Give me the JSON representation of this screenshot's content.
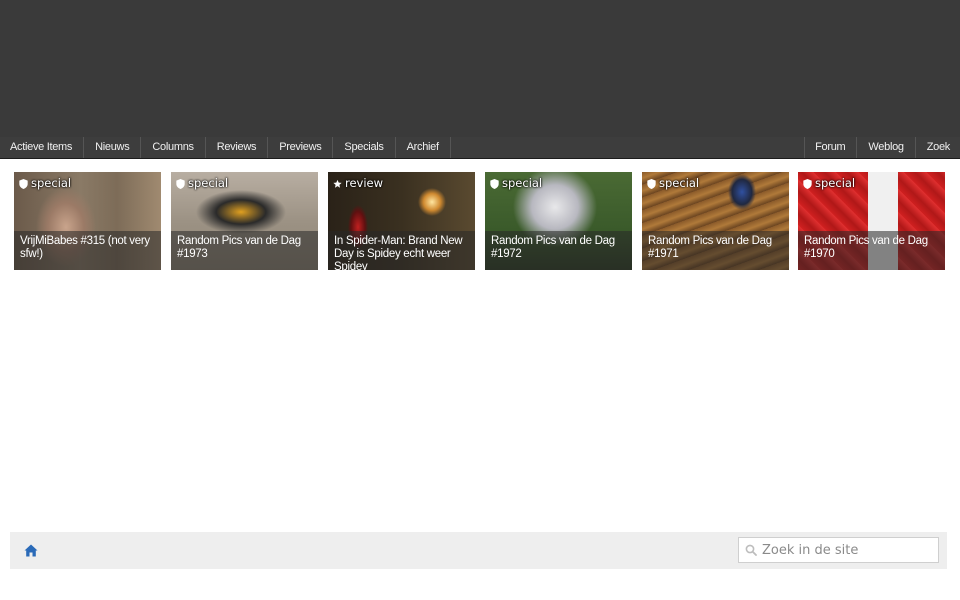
{
  "nav": {
    "left": [
      "Actieve Items",
      "Nieuws",
      "Columns",
      "Reviews",
      "Previews",
      "Specials",
      "Archief"
    ],
    "right": [
      "Forum",
      "Weblog",
      "Zoek"
    ]
  },
  "tiles": [
    {
      "tag": "special",
      "icon": "shield-icon",
      "title": "VrijMiBabes #315 (not very sfw!)"
    },
    {
      "tag": "special",
      "icon": "shield-icon",
      "title": "Random Pics van de Dag #1973"
    },
    {
      "tag": "review",
      "icon": "star-icon",
      "title": "In Spider-Man: Brand New Day is Spidey echt weer Spidey"
    },
    {
      "tag": "special",
      "icon": "shield-icon",
      "title": "Random Pics van de Dag #1972"
    },
    {
      "tag": "special",
      "icon": "shield-icon",
      "title": "Random Pics van de Dag #1971"
    },
    {
      "tag": "special",
      "icon": "shield-icon",
      "title": "Random Pics van de Dag #1970"
    }
  ],
  "footer": {
    "home_icon": "home-icon",
    "search_placeholder": "Zoek in de site"
  },
  "colors": {
    "banner": "#3a3a3a",
    "navbar": "#3d3d3d",
    "accent": "#2a6ab8",
    "footer_bg": "#eeeeee"
  }
}
